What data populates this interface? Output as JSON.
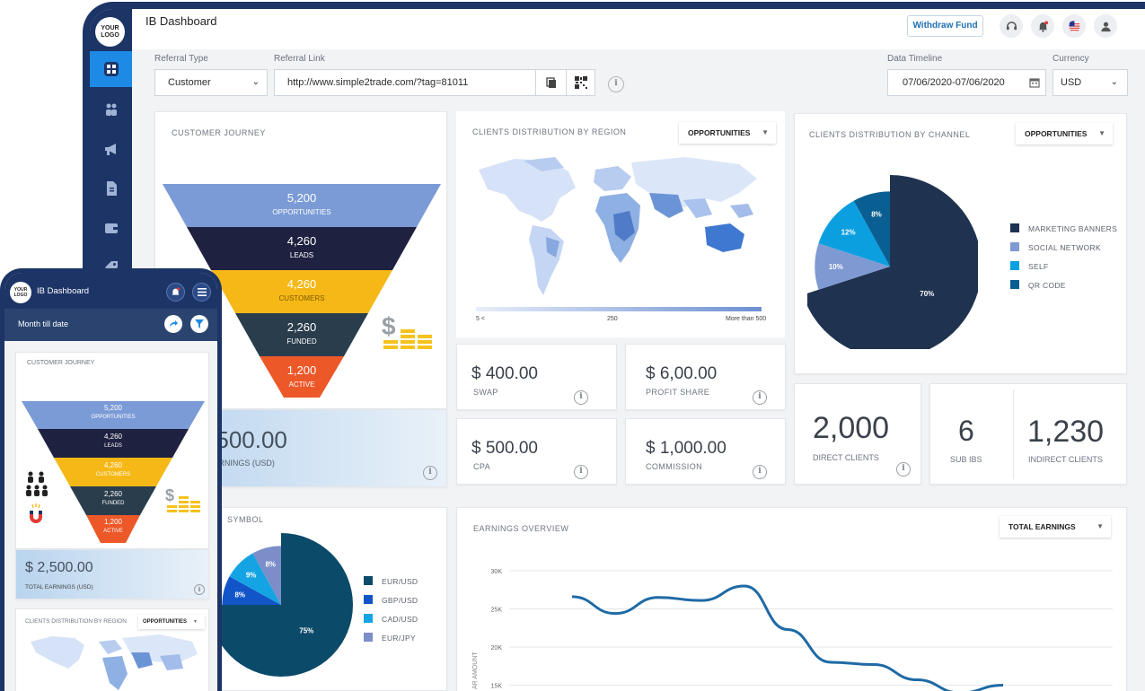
{
  "app": {
    "title": "IB Dashboard",
    "logo_text": "YOUR LOGO"
  },
  "header": {
    "withdraw_label": "Withdraw Fund"
  },
  "filters": {
    "referral_type_label": "Referral Type",
    "referral_type_value": "Customer",
    "referral_link_label": "Referral Link",
    "referral_link_value": "http://www.simple2trade.com/?tag=81011",
    "timeline_label": "Data Timeline",
    "timeline_value": "07/06/2020-07/06/2020",
    "currency_label": "Currency",
    "currency_value": "USD"
  },
  "journey": {
    "title": "CUSTOMER JOURNEY",
    "stages": [
      {
        "value": "5,200",
        "label": "OPPORTUNITIES",
        "color": "#7b9bd6"
      },
      {
        "value": "4,260",
        "label": "LEADS",
        "color": "#1e2240"
      },
      {
        "value": "4,260",
        "label": "CUSTOMERS",
        "color": "#f6b817"
      },
      {
        "value": "2,260",
        "label": "FUNDED",
        "color": "#2a3d4d"
      },
      {
        "value": "1,200",
        "label": "ACTIVE",
        "color": "#ed5829"
      }
    ],
    "earnings_value": "$ 2,500.00",
    "earnings_label": "TOTAL EARNINGS (USD)"
  },
  "region": {
    "title": "CLIENTS DISTRIBUTION BY REGION",
    "dropdown": "OPPORTUNITIES",
    "scale_labels": [
      "5 <",
      "250",
      "More than 500"
    ]
  },
  "channel": {
    "title": "CLIENTS DISTRIBUTION BY CHANNEL",
    "dropdown": "OPPORTUNITIES"
  },
  "kpis": [
    {
      "value": "$ 400.00",
      "label": "SWAP"
    },
    {
      "value": "$ 6,00.00",
      "label": "PROFIT SHARE"
    },
    {
      "value": "$ 500.00",
      "label": "CPA"
    },
    {
      "value": "$ 1,000.00",
      "label": "COMMISSION"
    }
  ],
  "clients": [
    {
      "value": "2,000",
      "label": "DIRECT CLIENTS"
    },
    {
      "value": "6",
      "label": "SUB IBS"
    },
    {
      "value": "1,230",
      "label": "INDIRECT CLIENTS"
    }
  ],
  "symbol": {
    "title_fragment": "SYMBOL"
  },
  "earnings_overview": {
    "title": "EARNINGS OVERVIEW",
    "dropdown": "TOTAL EARNINGS"
  },
  "mobile": {
    "title": "IB Dashboard",
    "subtitle": "Month till date",
    "region_title": "CLIENTS DISTRIBUTION BY REGION",
    "region_dropdown": "OPPORTUNITIES"
  },
  "chart_data": [
    {
      "type": "pie",
      "name": "clients-by-channel",
      "title": "CLIENTS DISTRIBUTION BY CHANNEL",
      "legend_position": "right",
      "slices": [
        {
          "label": "MARKETING BANNERS",
          "value": 70,
          "color": "#1f3250"
        },
        {
          "label": "SOCIAL NETWORK",
          "value": 10,
          "color": "#7f99d2"
        },
        {
          "label": "SELF",
          "value": 12,
          "color": "#0c9fe0"
        },
        {
          "label": "QR CODE",
          "value": 8,
          "color": "#0a5f92"
        }
      ]
    },
    {
      "type": "pie",
      "name": "by-symbol",
      "legend_position": "right",
      "slices": [
        {
          "label": "EUR/USD",
          "value": 75,
          "color": "#0c4a6a"
        },
        {
          "label": "GBP/USD",
          "value": 8,
          "color": "#1255c8"
        },
        {
          "label": "CAD/USD",
          "value": 9,
          "color": "#14a4e3"
        },
        {
          "label": "EUR/JPY",
          "value": 8,
          "color": "#7b8ec9"
        }
      ]
    },
    {
      "type": "line",
      "name": "earnings-overview",
      "title": "EARNINGS OVERVIEW",
      "ylabel": "AR AMOUNT",
      "y_ticks": [
        "30K",
        "25K",
        "20K",
        "15K"
      ],
      "ylim": [
        14000,
        30000
      ],
      "grid": true,
      "series": [
        {
          "values": [
            26600,
            24400,
            26500,
            26100,
            28000,
            22300,
            18000,
            17700,
            15700,
            14000,
            15000
          ]
        }
      ]
    }
  ]
}
